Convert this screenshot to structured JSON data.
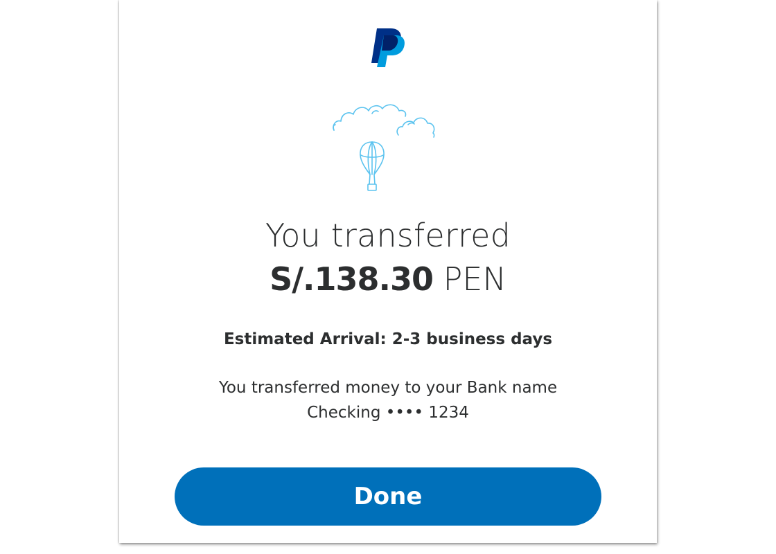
{
  "brand": {
    "logo_icon": "paypal-logo-icon",
    "primary_dark": "#003087",
    "primary_light": "#009cde",
    "button_color": "#0070ba"
  },
  "illustration": {
    "icon": "hot-air-balloon-clouds-icon",
    "stroke_color": "#5bc3ef"
  },
  "confirmation": {
    "headline": "You transferred",
    "amount": "S/.138.30",
    "currency": "PEN",
    "arrival": "Estimated Arrival: 2-3 business days",
    "message_line1": "You transferred money to your Bank name",
    "message_line2": "Checking •••• 1234"
  },
  "actions": {
    "done_label": "Done"
  }
}
